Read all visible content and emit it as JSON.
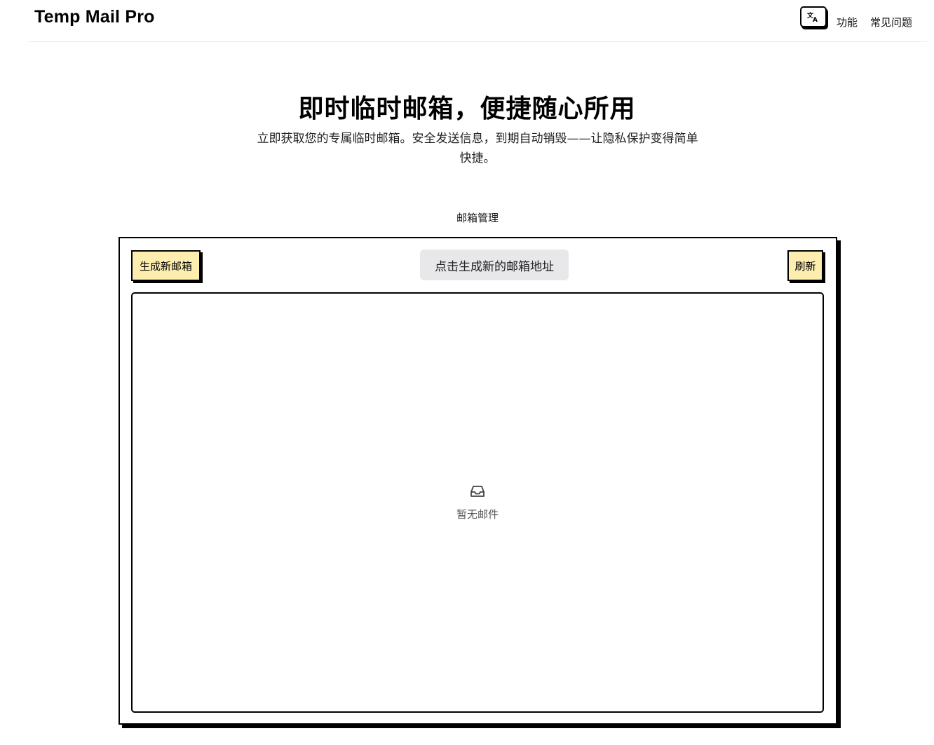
{
  "header": {
    "brand": "Temp Mail Pro",
    "language_icon": "translate-icon",
    "nav": [
      {
        "label": "功能"
      },
      {
        "label": "常见问题"
      }
    ]
  },
  "hero": {
    "title": "即时临时邮箱，便捷随心所用",
    "subtitle": "立即获取您的专属临时邮箱。安全发送信息，到期自动销毁——让隐私保护变得简单快捷。"
  },
  "mailbox": {
    "section_label": "邮箱管理",
    "generate_button": "生成新邮箱",
    "address_placeholder": "点击生成新的邮箱地址",
    "refresh_button": "刷新",
    "empty_icon": "inbox-icon",
    "empty_text": "暂无邮件"
  },
  "colors": {
    "button_fill": "#fdeeb0",
    "address_fill": "#e8e8ea",
    "border": "#000000"
  }
}
